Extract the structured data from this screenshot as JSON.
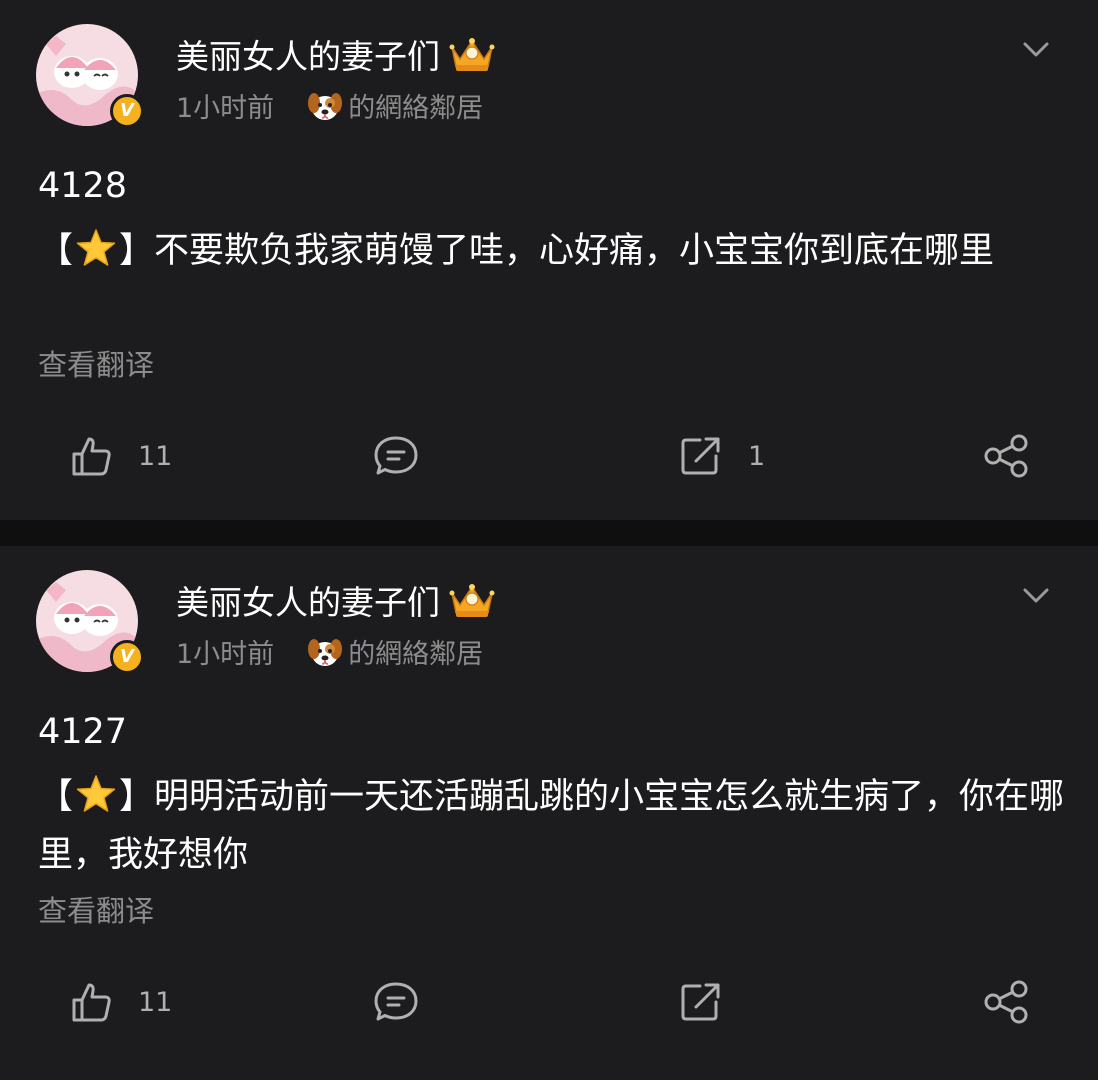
{
  "posts": [
    {
      "username": "美丽女人的妻子们",
      "time": "1小时前",
      "source": "的網絡鄰居",
      "number": "4128",
      "tag_open": "【",
      "tag_close": "】",
      "text": "不要欺负我家萌馒了哇，心好痛，小宝宝你到底在哪里",
      "translate_label": "查看翻译",
      "likes": "11",
      "comments": "",
      "reposts": "1",
      "icons": [
        "chevron-down-icon",
        "crown-icon",
        "dog-icon",
        "star-icon",
        "like-icon",
        "comment-icon",
        "repost-icon",
        "share-icon"
      ]
    },
    {
      "username": "美丽女人的妻子们",
      "time": "1小时前",
      "source": "的網絡鄰居",
      "number": "4127",
      "tag_open": "【",
      "tag_close": "】",
      "text": "明明活动前一天还活蹦乱跳的小宝宝怎么就生病了，你在哪里，我好想你",
      "translate_label": "查看翻译",
      "likes": "11",
      "comments": "",
      "reposts": "",
      "icons": [
        "chevron-down-icon",
        "crown-icon",
        "dog-icon",
        "star-icon",
        "like-icon",
        "comment-icon",
        "repost-icon",
        "share-icon"
      ]
    }
  ],
  "colors": {
    "background": "#0f0f0f",
    "card": "#1c1c1e",
    "text": "#ffffff",
    "secondary_text": "#8c8c8c",
    "verified_badge": "#f5b21e"
  },
  "badge_letter": "V"
}
